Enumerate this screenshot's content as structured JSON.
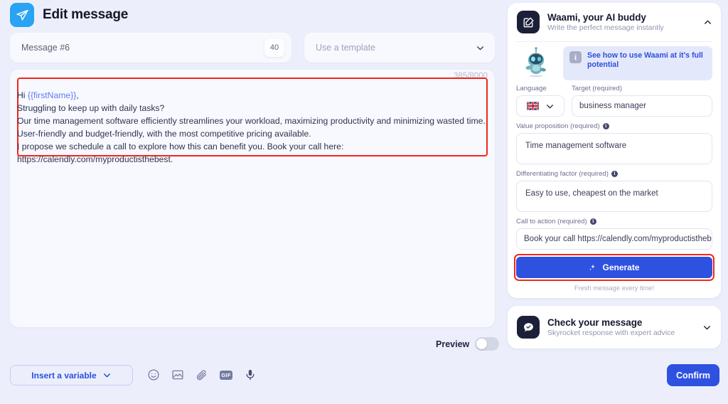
{
  "header": {
    "title": "Edit message",
    "icon": "send-icon"
  },
  "top_fields": {
    "message_name": "Message #6",
    "message_count_badge": "40",
    "template_placeholder": "Use a template"
  },
  "editor": {
    "char_count": "385/8000",
    "greeting_prefix": "Hi ",
    "variable_token": "{{firstName}}",
    "greeting_suffix": ",",
    "body_lines": "Struggling to keep up with daily tasks?\nOur time management software efficiently streamlines your workload, maximizing productivity and minimizing wasted time.\nUser-friendly and budget-friendly, with the most competitive pricing available.\nI propose we schedule a call to explore how this can benefit you. Book your call here:\nhttps://calendly.com/myproductisthebest.",
    "highlight_color": "#f4251e"
  },
  "preview": {
    "label": "Preview",
    "enabled": false
  },
  "bottom_toolbar": {
    "insert_variable_label": "Insert a variable",
    "icons": [
      "emoji-icon",
      "image-icon",
      "attachment-icon",
      "gif-icon",
      "microphone-icon"
    ]
  },
  "confirm": {
    "label": "Confirm",
    "color": "#2f51e0"
  },
  "waami_panel": {
    "title": "Waami, your AI buddy",
    "subtitle": "Write the perfect message instantly",
    "collapse_state": "expanded",
    "info_banner": "See how to use Waami at it's full potential",
    "language": {
      "label": "Language",
      "flag": "uk-flag"
    },
    "target": {
      "label": "Target (required)",
      "value": "business manager"
    },
    "value_proposition": {
      "label": "Value proposition (required)",
      "value": "Time management software"
    },
    "differentiating_factor": {
      "label": "Differentiating factor (required)",
      "value": "Easy to use, cheapest on the market"
    },
    "call_to_action": {
      "label": "Call to action (required)",
      "value": "Book your call https://calendly.com/myproductisthebest"
    },
    "generate": {
      "label": "Generate",
      "note": "Fresh message every time!",
      "color": "#2f51e0"
    }
  },
  "check_panel": {
    "title": "Check your message",
    "subtitle": "Skyrocket response with expert advice",
    "collapse_state": "collapsed"
  }
}
